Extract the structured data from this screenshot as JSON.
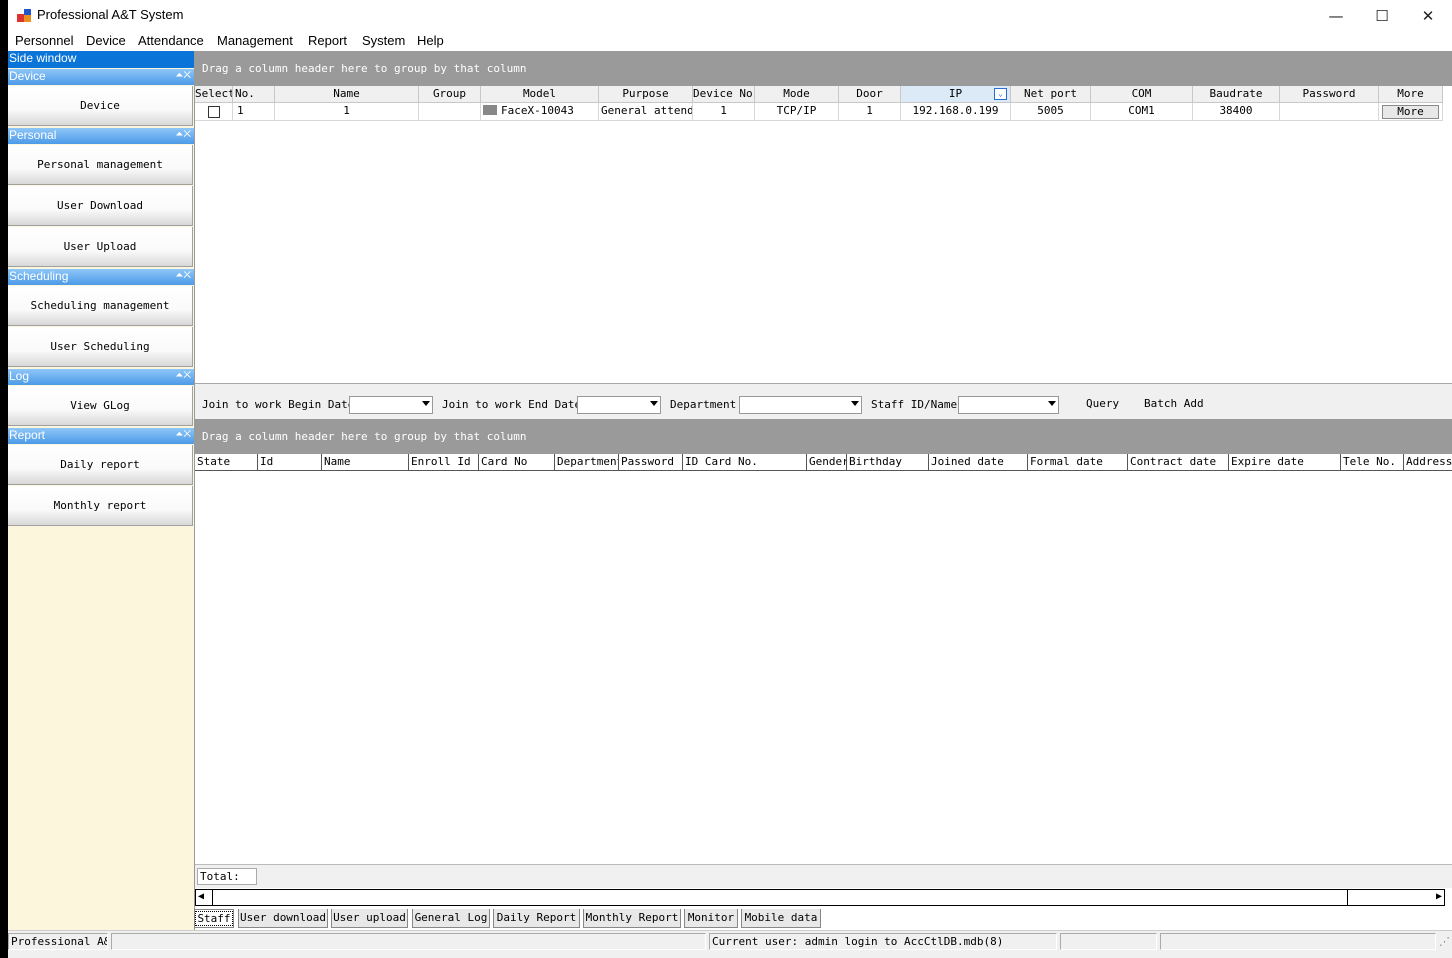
{
  "window": {
    "title": "Professional A&T System",
    "minimize": "—",
    "maximize": "☐",
    "close": "✕"
  },
  "menu": [
    "Personnel",
    "Device",
    "Attendance",
    "Management",
    "Report",
    "System",
    "Help"
  ],
  "side": {
    "header": "Side window",
    "groups": [
      {
        "label": "Device",
        "items": [
          "Device"
        ]
      },
      {
        "label": "Personal",
        "items": [
          "Personal management",
          "User Download",
          "User Upload"
        ]
      },
      {
        "label": "Scheduling",
        "items": [
          "Scheduling management",
          "User Scheduling"
        ]
      },
      {
        "label": "Log",
        "items": [
          "View GLog"
        ]
      },
      {
        "label": "Report",
        "items": [
          "Daily report",
          "Monthly report"
        ]
      }
    ]
  },
  "device_grid": {
    "drag_hint": "Drag a column header here to group by that column",
    "columns": [
      "Select",
      "No.",
      "Name",
      "Group",
      "Model",
      "Purpose",
      "Device No.",
      "Mode",
      "Door",
      "IP",
      "Net port",
      "COM",
      "Baudrate",
      "Password",
      "More"
    ],
    "rows": [
      {
        "no": "1",
        "name": "1",
        "group": "",
        "model": "FaceX-10043",
        "purpose": "General attendance",
        "device_no": "1",
        "mode": "TCP/IP",
        "door": "1",
        "ip": "192.168.0.199",
        "net_port": "5005",
        "com": "COM1",
        "baudrate": "38400",
        "password": "",
        "more": "More"
      }
    ]
  },
  "filter": {
    "begin_label": "Join to work Begin Date",
    "end_label": "Join to work End Date",
    "dept_label": "Department",
    "staff_label": "Staff ID/Name",
    "query": "Query",
    "batch_add": "Batch Add"
  },
  "staff_grid": {
    "drag_hint": "Drag a column header here to group by that column",
    "columns": [
      "State",
      "Id",
      "Name",
      "Enroll Id",
      "Card No",
      "Department",
      "Password",
      "ID Card No.",
      "Gender",
      "Birthday",
      "Joined date",
      "Formal date",
      "Contract date",
      "Expire date",
      "Tele No.",
      "Address"
    ],
    "total_label": "Total:"
  },
  "tabs": [
    "Staff",
    "User download",
    "User upload",
    "General Log",
    "Daily Report",
    "Monthly Report",
    "Monitor",
    "Mobile data"
  ],
  "status": {
    "app": "Professional A&T",
    "user": "Current user: admin  login to AccCtlDB.mdb(8)"
  }
}
